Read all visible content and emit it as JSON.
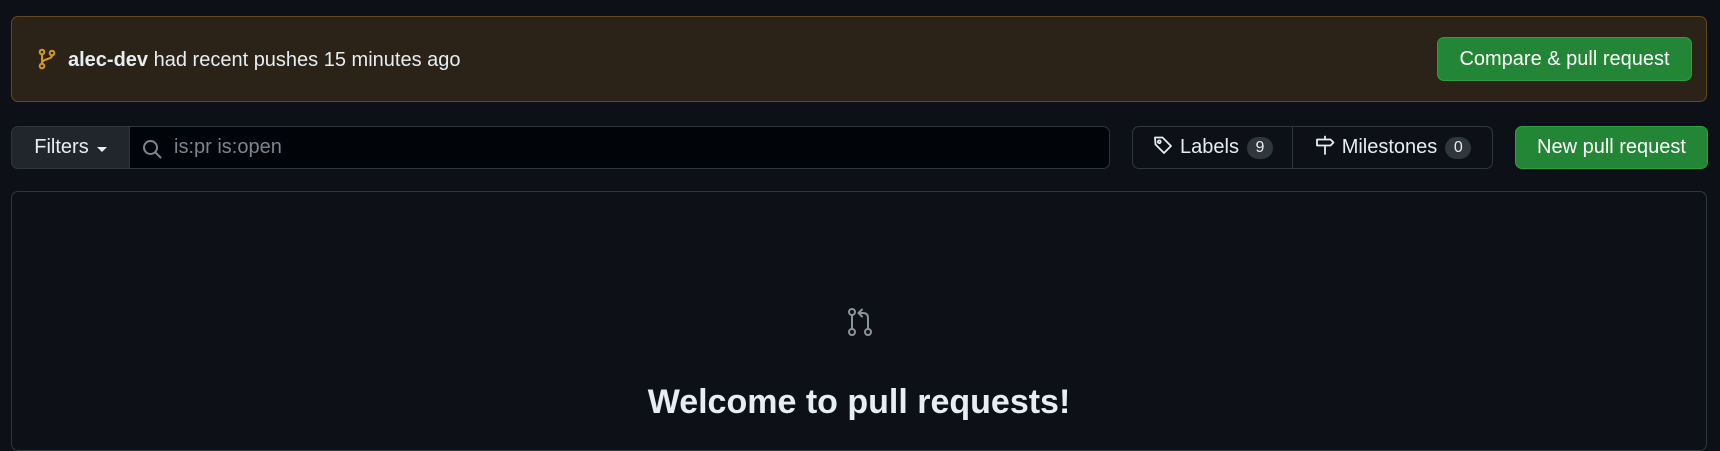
{
  "push_banner": {
    "user": "alec-dev",
    "message": " had recent pushes 15 minutes ago",
    "compare_button": "Compare & pull request",
    "icon": "git-branch-icon",
    "accent_color": "#d29922"
  },
  "toolbar": {
    "filters_label": "Filters",
    "search": {
      "value": "",
      "placeholder": "is:pr is:open"
    },
    "labels": {
      "label": "Labels",
      "count": "9"
    },
    "milestones": {
      "label": "Milestones",
      "count": "0"
    },
    "new_pr_button": "New pull request"
  },
  "blankslate": {
    "icon": "git-pull-request-icon",
    "title": "Welcome to pull requests!"
  },
  "colors": {
    "background": "#0d1117",
    "primary_button": "#238636",
    "banner_background": "#2b2317"
  }
}
